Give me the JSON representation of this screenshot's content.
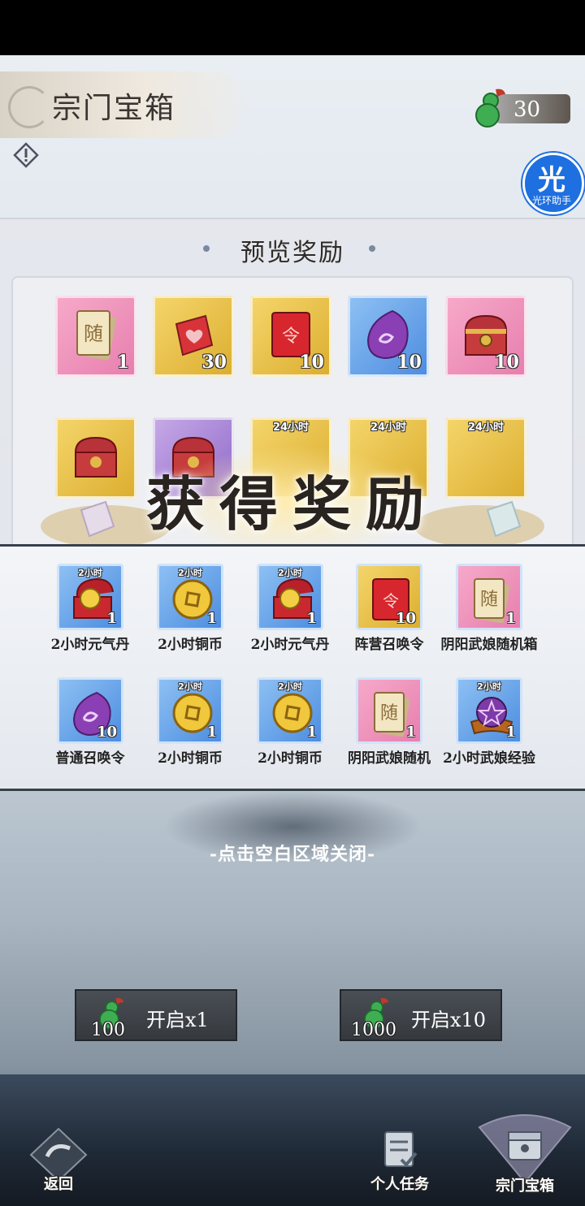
{
  "header": {
    "title": "宗门宝箱",
    "currency_amount": "30"
  },
  "helper": {
    "glyph": "光",
    "label": "光环助手"
  },
  "preview": {
    "title": "预览奖励",
    "row1": [
      {
        "icon": "random-card-icon",
        "count": "1",
        "bg": "pink"
      },
      {
        "icon": "red-bag-icon",
        "count": "30",
        "bg": "gold"
      },
      {
        "icon": "summon-order-icon",
        "count": "10",
        "bg": "gold"
      },
      {
        "icon": "purple-stone-icon",
        "count": "10",
        "bg": "blue"
      },
      {
        "icon": "treasure-chest-icon",
        "count": "10",
        "bg": "pink"
      }
    ],
    "row2_tags": [
      "24小时",
      "24小时",
      "24小时"
    ]
  },
  "reward_banner": {
    "title": "获得奖励"
  },
  "rewards": [
    {
      "name": "2小时元气丹",
      "tag": "2小时",
      "count": "1",
      "icon": "elixir-box-icon",
      "bg": "blue"
    },
    {
      "name": "2小时铜币",
      "tag": "2小时",
      "count": "1",
      "icon": "copper-coin-icon",
      "bg": "blue"
    },
    {
      "name": "2小时元气丹",
      "tag": "2小时",
      "count": "1",
      "icon": "elixir-box-icon",
      "bg": "blue"
    },
    {
      "name": "阵营召唤令",
      "tag": "",
      "count": "10",
      "icon": "summon-order-icon",
      "bg": "gold"
    },
    {
      "name": "阴阳武娘随机箱",
      "tag": "",
      "count": "1",
      "icon": "random-card-icon",
      "bg": "pink"
    },
    {
      "name": "普通召唤令",
      "tag": "",
      "count": "10",
      "icon": "purple-stone-icon",
      "bg": "blue"
    },
    {
      "name": "2小时铜币",
      "tag": "2小时",
      "count": "1",
      "icon": "copper-coin-icon",
      "bg": "blue"
    },
    {
      "name": "2小时铜币",
      "tag": "2小时",
      "count": "1",
      "icon": "copper-coin-icon",
      "bg": "blue"
    },
    {
      "name": "阴阳武娘随机",
      "tag": "",
      "count": "1",
      "icon": "random-card-icon",
      "bg": "pink"
    },
    {
      "name": "2小时武娘经验",
      "tag": "2小时",
      "count": "1",
      "icon": "exp-orb-icon",
      "bg": "blue"
    }
  ],
  "close_hint": "-点击空白区域关闭-",
  "buttons": {
    "open_one": {
      "label": "开启x1",
      "cost": "100"
    },
    "open_ten": {
      "label": "开启x10",
      "cost": "1000"
    }
  },
  "nav": {
    "back": "返回",
    "tasks": "个人任务",
    "chest": "宗门宝箱"
  }
}
